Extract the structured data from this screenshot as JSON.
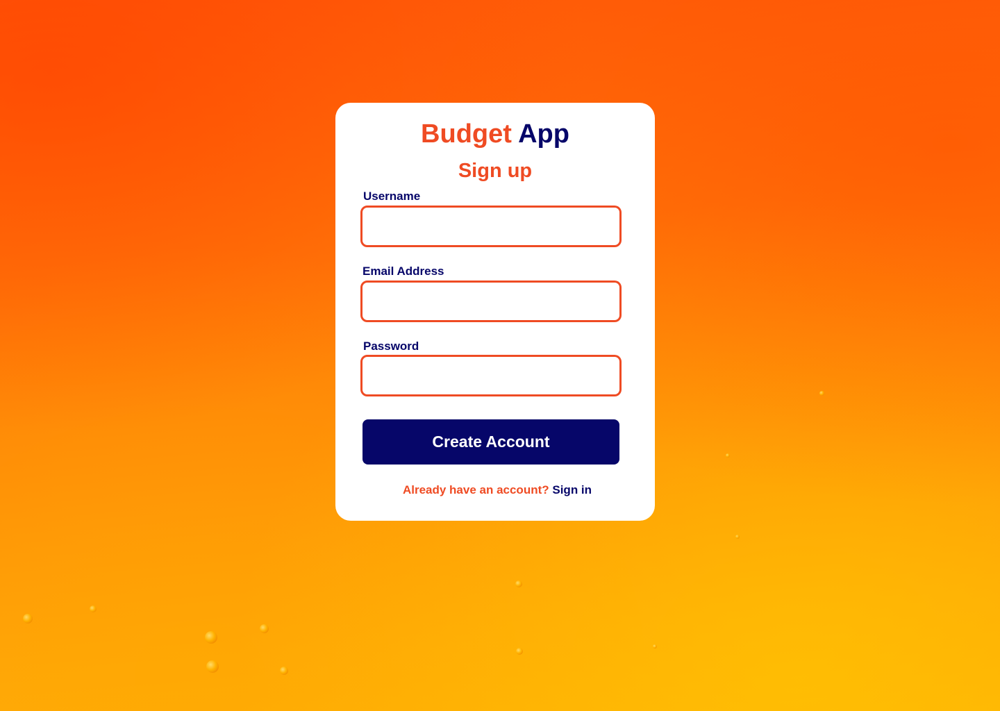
{
  "app": {
    "title_accent": "Budget",
    "title_main": "App"
  },
  "form": {
    "heading": "Sign up",
    "fields": [
      {
        "label": "Username",
        "value": "",
        "placeholder": ""
      },
      {
        "label": "Email Address",
        "value": "",
        "placeholder": ""
      },
      {
        "label": "Password",
        "value": "",
        "placeholder": ""
      }
    ],
    "submit_label": "Create Account",
    "footer_text": "Already have an account?",
    "footer_link": "Sign in"
  },
  "colors": {
    "accent": "#ef4b23",
    "primary": "#060669",
    "card_background": "#ffffff"
  }
}
